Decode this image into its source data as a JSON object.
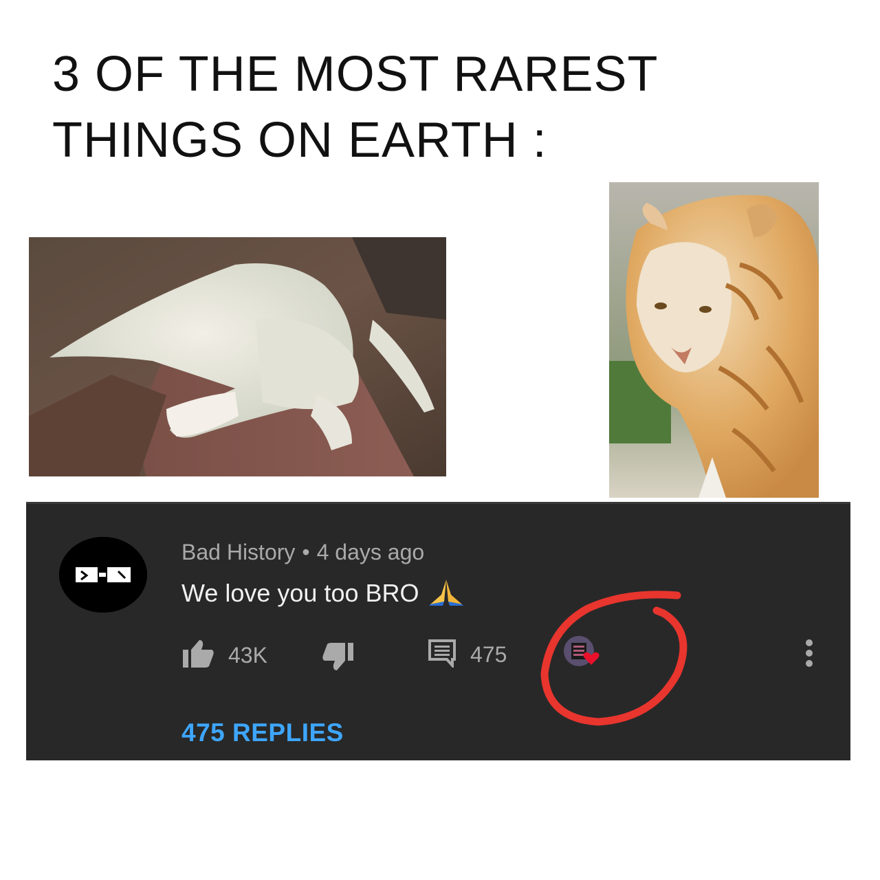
{
  "meme": {
    "title_line1": "3 OF THE MOST RAREST",
    "title_line2": "THINGS ON EARTH :"
  },
  "images": {
    "left": "albino-alligator-photo",
    "right": "golden-tiger-photo"
  },
  "comment": {
    "author": "Bad History",
    "separator": "•",
    "time": "4 days ago",
    "text": "We love you too BRO",
    "emoji": "folded-hands-emoji",
    "likes": "43K",
    "reply_count": "475",
    "replies_link": "475 REPLIES",
    "hearted_by_creator": true
  },
  "colors": {
    "panel_bg": "#282828",
    "meta_text": "#aaaaaa",
    "comment_text": "#f1f1f1",
    "link_blue": "#3ea6ff",
    "annotation_red": "#e8352e",
    "heart_red": "#e8102a"
  },
  "icons": [
    "thumbs-up-icon",
    "thumbs-down-icon",
    "comment-icon",
    "creator-heart-icon",
    "more-vert-icon"
  ]
}
